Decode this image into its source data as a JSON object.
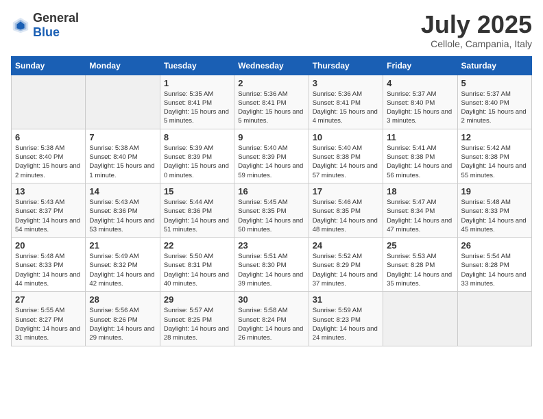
{
  "header": {
    "logo_general": "General",
    "logo_blue": "Blue",
    "month_year": "July 2025",
    "location": "Cellole, Campania, Italy"
  },
  "calendar": {
    "days_of_week": [
      "Sunday",
      "Monday",
      "Tuesday",
      "Wednesday",
      "Thursday",
      "Friday",
      "Saturday"
    ],
    "weeks": [
      [
        {
          "day": "",
          "sunrise": "",
          "sunset": "",
          "daylight": ""
        },
        {
          "day": "",
          "sunrise": "",
          "sunset": "",
          "daylight": ""
        },
        {
          "day": "1",
          "sunrise": "Sunrise: 5:35 AM",
          "sunset": "Sunset: 8:41 PM",
          "daylight": "Daylight: 15 hours and 5 minutes."
        },
        {
          "day": "2",
          "sunrise": "Sunrise: 5:36 AM",
          "sunset": "Sunset: 8:41 PM",
          "daylight": "Daylight: 15 hours and 5 minutes."
        },
        {
          "day": "3",
          "sunrise": "Sunrise: 5:36 AM",
          "sunset": "Sunset: 8:41 PM",
          "daylight": "Daylight: 15 hours and 4 minutes."
        },
        {
          "day": "4",
          "sunrise": "Sunrise: 5:37 AM",
          "sunset": "Sunset: 8:40 PM",
          "daylight": "Daylight: 15 hours and 3 minutes."
        },
        {
          "day": "5",
          "sunrise": "Sunrise: 5:37 AM",
          "sunset": "Sunset: 8:40 PM",
          "daylight": "Daylight: 15 hours and 2 minutes."
        }
      ],
      [
        {
          "day": "6",
          "sunrise": "Sunrise: 5:38 AM",
          "sunset": "Sunset: 8:40 PM",
          "daylight": "Daylight: 15 hours and 2 minutes."
        },
        {
          "day": "7",
          "sunrise": "Sunrise: 5:38 AM",
          "sunset": "Sunset: 8:40 PM",
          "daylight": "Daylight: 15 hours and 1 minute."
        },
        {
          "day": "8",
          "sunrise": "Sunrise: 5:39 AM",
          "sunset": "Sunset: 8:39 PM",
          "daylight": "Daylight: 15 hours and 0 minutes."
        },
        {
          "day": "9",
          "sunrise": "Sunrise: 5:40 AM",
          "sunset": "Sunset: 8:39 PM",
          "daylight": "Daylight: 14 hours and 59 minutes."
        },
        {
          "day": "10",
          "sunrise": "Sunrise: 5:40 AM",
          "sunset": "Sunset: 8:38 PM",
          "daylight": "Daylight: 14 hours and 57 minutes."
        },
        {
          "day": "11",
          "sunrise": "Sunrise: 5:41 AM",
          "sunset": "Sunset: 8:38 PM",
          "daylight": "Daylight: 14 hours and 56 minutes."
        },
        {
          "day": "12",
          "sunrise": "Sunrise: 5:42 AM",
          "sunset": "Sunset: 8:38 PM",
          "daylight": "Daylight: 14 hours and 55 minutes."
        }
      ],
      [
        {
          "day": "13",
          "sunrise": "Sunrise: 5:43 AM",
          "sunset": "Sunset: 8:37 PM",
          "daylight": "Daylight: 14 hours and 54 minutes."
        },
        {
          "day": "14",
          "sunrise": "Sunrise: 5:43 AM",
          "sunset": "Sunset: 8:36 PM",
          "daylight": "Daylight: 14 hours and 53 minutes."
        },
        {
          "day": "15",
          "sunrise": "Sunrise: 5:44 AM",
          "sunset": "Sunset: 8:36 PM",
          "daylight": "Daylight: 14 hours and 51 minutes."
        },
        {
          "day": "16",
          "sunrise": "Sunrise: 5:45 AM",
          "sunset": "Sunset: 8:35 PM",
          "daylight": "Daylight: 14 hours and 50 minutes."
        },
        {
          "day": "17",
          "sunrise": "Sunrise: 5:46 AM",
          "sunset": "Sunset: 8:35 PM",
          "daylight": "Daylight: 14 hours and 48 minutes."
        },
        {
          "day": "18",
          "sunrise": "Sunrise: 5:47 AM",
          "sunset": "Sunset: 8:34 PM",
          "daylight": "Daylight: 14 hours and 47 minutes."
        },
        {
          "day": "19",
          "sunrise": "Sunrise: 5:48 AM",
          "sunset": "Sunset: 8:33 PM",
          "daylight": "Daylight: 14 hours and 45 minutes."
        }
      ],
      [
        {
          "day": "20",
          "sunrise": "Sunrise: 5:48 AM",
          "sunset": "Sunset: 8:33 PM",
          "daylight": "Daylight: 14 hours and 44 minutes."
        },
        {
          "day": "21",
          "sunrise": "Sunrise: 5:49 AM",
          "sunset": "Sunset: 8:32 PM",
          "daylight": "Daylight: 14 hours and 42 minutes."
        },
        {
          "day": "22",
          "sunrise": "Sunrise: 5:50 AM",
          "sunset": "Sunset: 8:31 PM",
          "daylight": "Daylight: 14 hours and 40 minutes."
        },
        {
          "day": "23",
          "sunrise": "Sunrise: 5:51 AM",
          "sunset": "Sunset: 8:30 PM",
          "daylight": "Daylight: 14 hours and 39 minutes."
        },
        {
          "day": "24",
          "sunrise": "Sunrise: 5:52 AM",
          "sunset": "Sunset: 8:29 PM",
          "daylight": "Daylight: 14 hours and 37 minutes."
        },
        {
          "day": "25",
          "sunrise": "Sunrise: 5:53 AM",
          "sunset": "Sunset: 8:28 PM",
          "daylight": "Daylight: 14 hours and 35 minutes."
        },
        {
          "day": "26",
          "sunrise": "Sunrise: 5:54 AM",
          "sunset": "Sunset: 8:28 PM",
          "daylight": "Daylight: 14 hours and 33 minutes."
        }
      ],
      [
        {
          "day": "27",
          "sunrise": "Sunrise: 5:55 AM",
          "sunset": "Sunset: 8:27 PM",
          "daylight": "Daylight: 14 hours and 31 minutes."
        },
        {
          "day": "28",
          "sunrise": "Sunrise: 5:56 AM",
          "sunset": "Sunset: 8:26 PM",
          "daylight": "Daylight: 14 hours and 29 minutes."
        },
        {
          "day": "29",
          "sunrise": "Sunrise: 5:57 AM",
          "sunset": "Sunset: 8:25 PM",
          "daylight": "Daylight: 14 hours and 28 minutes."
        },
        {
          "day": "30",
          "sunrise": "Sunrise: 5:58 AM",
          "sunset": "Sunset: 8:24 PM",
          "daylight": "Daylight: 14 hours and 26 minutes."
        },
        {
          "day": "31",
          "sunrise": "Sunrise: 5:59 AM",
          "sunset": "Sunset: 8:23 PM",
          "daylight": "Daylight: 14 hours and 24 minutes."
        },
        {
          "day": "",
          "sunrise": "",
          "sunset": "",
          "daylight": ""
        },
        {
          "day": "",
          "sunrise": "",
          "sunset": "",
          "daylight": ""
        }
      ]
    ]
  }
}
